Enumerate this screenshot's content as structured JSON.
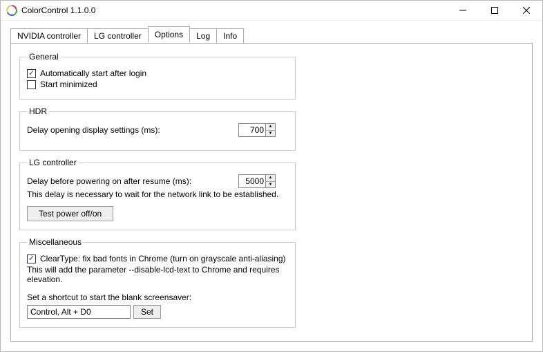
{
  "window": {
    "title": "ColorControl 1.1.0.0"
  },
  "tabs": {
    "nvidia": "NVIDIA controller",
    "lg": "LG controller",
    "options": "Options",
    "log": "Log",
    "info": "Info"
  },
  "general": {
    "legend": "General",
    "autostart_label": "Automatically start after login",
    "autostart_checked": true,
    "start_min_label": "Start minimized",
    "start_min_checked": false
  },
  "hdr": {
    "legend": "HDR",
    "delay_label": "Delay opening display settings (ms):",
    "delay_value": "700"
  },
  "lg_group": {
    "legend": "LG controller",
    "delay_label": "Delay before powering on after resume (ms):",
    "delay_value": "5000",
    "desc": "This delay is necessary to wait for the network link to be established.",
    "test_btn": "Test power off/on"
  },
  "misc": {
    "legend": "Miscellaneous",
    "cleartype_label": "ClearType: fix bad fonts in Chrome (turn on grayscale anti-aliasing)",
    "cleartype_checked": true,
    "cleartype_desc": "This will add the parameter --disable-lcd-text to Chrome and requires elevation.",
    "shortcut_label": "Set a shortcut to start the blank screensaver:",
    "shortcut_value": "Control, Alt + D0",
    "set_btn": "Set"
  }
}
